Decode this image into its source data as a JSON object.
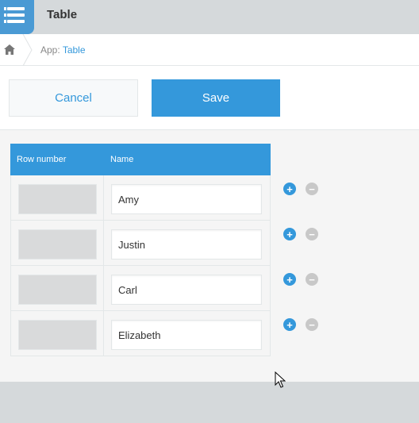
{
  "app": {
    "title": "Table",
    "icon": "table-list-icon"
  },
  "breadcrumb": {
    "prefix": "App:",
    "link": "Table"
  },
  "actions": {
    "cancel_label": "Cancel",
    "save_label": "Save"
  },
  "table": {
    "columns": [
      "Row number",
      "Name"
    ],
    "rows": [
      {
        "row_number": "",
        "name": "Amy"
      },
      {
        "row_number": "",
        "name": "Justin"
      },
      {
        "row_number": "",
        "name": "Carl"
      },
      {
        "row_number": "",
        "name": "Elizabeth"
      }
    ]
  },
  "row_controls": {
    "add_symbol": "+",
    "remove_symbol": "−"
  },
  "colors": {
    "accent": "#3498db",
    "header_bg": "#d5d9db",
    "content_bg": "#f5f5f5",
    "remove_btn": "#c8c8c8"
  }
}
